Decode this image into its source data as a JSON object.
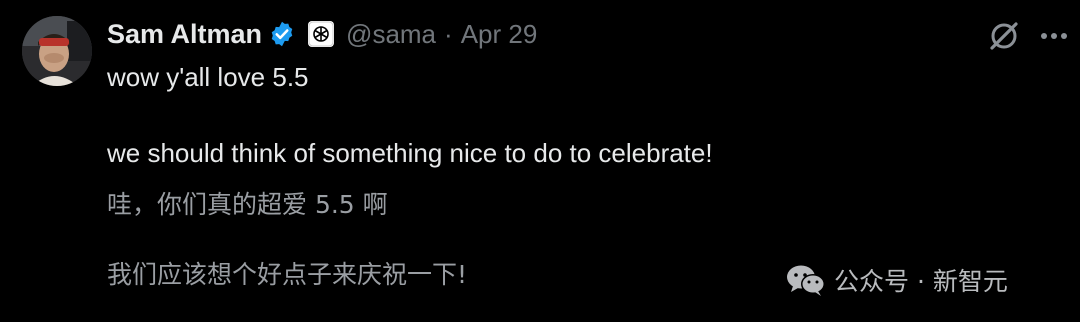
{
  "tweet": {
    "author": {
      "display_name": "Sam Altman",
      "handle": "@sama",
      "avatar_icon": "avatar-photo",
      "verified_icon": "verified-badge-icon",
      "affiliate_icon": "openai-logo-icon"
    },
    "separator": "·",
    "date": "Apr 29",
    "lines": [
      "wow y'all love 5.5",
      "we should think of something nice to do to celebrate!"
    ],
    "translations": [
      "哇，你们真的超爱 5.5 啊",
      "我们应该想个好点子来庆祝一下!"
    ],
    "actions": {
      "grok_icon": "grok-icon",
      "more_icon": "more-options-icon"
    }
  },
  "watermark": {
    "text": "公众号 · 新智元",
    "icon": "wechat-icon"
  },
  "colors": {
    "background": "#000000",
    "text_primary": "#e7e9ea",
    "text_secondary": "#71767b",
    "verified_blue": "#1d9bf0",
    "translation_text": "#9a9ea3"
  }
}
